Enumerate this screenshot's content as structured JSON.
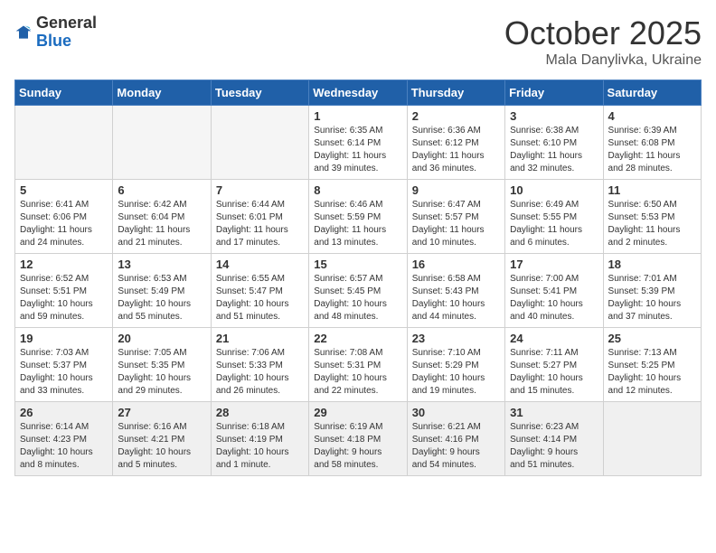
{
  "logo": {
    "general": "General",
    "blue": "Blue"
  },
  "header": {
    "month": "October 2025",
    "location": "Mala Danylivka, Ukraine"
  },
  "weekdays": [
    "Sunday",
    "Monday",
    "Tuesday",
    "Wednesday",
    "Thursday",
    "Friday",
    "Saturday"
  ],
  "weeks": [
    [
      {
        "day": "",
        "info": ""
      },
      {
        "day": "",
        "info": ""
      },
      {
        "day": "",
        "info": ""
      },
      {
        "day": "1",
        "info": "Sunrise: 6:35 AM\nSunset: 6:14 PM\nDaylight: 11 hours\nand 39 minutes."
      },
      {
        "day": "2",
        "info": "Sunrise: 6:36 AM\nSunset: 6:12 PM\nDaylight: 11 hours\nand 36 minutes."
      },
      {
        "day": "3",
        "info": "Sunrise: 6:38 AM\nSunset: 6:10 PM\nDaylight: 11 hours\nand 32 minutes."
      },
      {
        "day": "4",
        "info": "Sunrise: 6:39 AM\nSunset: 6:08 PM\nDaylight: 11 hours\nand 28 minutes."
      }
    ],
    [
      {
        "day": "5",
        "info": "Sunrise: 6:41 AM\nSunset: 6:06 PM\nDaylight: 11 hours\nand 24 minutes."
      },
      {
        "day": "6",
        "info": "Sunrise: 6:42 AM\nSunset: 6:04 PM\nDaylight: 11 hours\nand 21 minutes."
      },
      {
        "day": "7",
        "info": "Sunrise: 6:44 AM\nSunset: 6:01 PM\nDaylight: 11 hours\nand 17 minutes."
      },
      {
        "day": "8",
        "info": "Sunrise: 6:46 AM\nSunset: 5:59 PM\nDaylight: 11 hours\nand 13 minutes."
      },
      {
        "day": "9",
        "info": "Sunrise: 6:47 AM\nSunset: 5:57 PM\nDaylight: 11 hours\nand 10 minutes."
      },
      {
        "day": "10",
        "info": "Sunrise: 6:49 AM\nSunset: 5:55 PM\nDaylight: 11 hours\nand 6 minutes."
      },
      {
        "day": "11",
        "info": "Sunrise: 6:50 AM\nSunset: 5:53 PM\nDaylight: 11 hours\nand 2 minutes."
      }
    ],
    [
      {
        "day": "12",
        "info": "Sunrise: 6:52 AM\nSunset: 5:51 PM\nDaylight: 10 hours\nand 59 minutes."
      },
      {
        "day": "13",
        "info": "Sunrise: 6:53 AM\nSunset: 5:49 PM\nDaylight: 10 hours\nand 55 minutes."
      },
      {
        "day": "14",
        "info": "Sunrise: 6:55 AM\nSunset: 5:47 PM\nDaylight: 10 hours\nand 51 minutes."
      },
      {
        "day": "15",
        "info": "Sunrise: 6:57 AM\nSunset: 5:45 PM\nDaylight: 10 hours\nand 48 minutes."
      },
      {
        "day": "16",
        "info": "Sunrise: 6:58 AM\nSunset: 5:43 PM\nDaylight: 10 hours\nand 44 minutes."
      },
      {
        "day": "17",
        "info": "Sunrise: 7:00 AM\nSunset: 5:41 PM\nDaylight: 10 hours\nand 40 minutes."
      },
      {
        "day": "18",
        "info": "Sunrise: 7:01 AM\nSunset: 5:39 PM\nDaylight: 10 hours\nand 37 minutes."
      }
    ],
    [
      {
        "day": "19",
        "info": "Sunrise: 7:03 AM\nSunset: 5:37 PM\nDaylight: 10 hours\nand 33 minutes."
      },
      {
        "day": "20",
        "info": "Sunrise: 7:05 AM\nSunset: 5:35 PM\nDaylight: 10 hours\nand 29 minutes."
      },
      {
        "day": "21",
        "info": "Sunrise: 7:06 AM\nSunset: 5:33 PM\nDaylight: 10 hours\nand 26 minutes."
      },
      {
        "day": "22",
        "info": "Sunrise: 7:08 AM\nSunset: 5:31 PM\nDaylight: 10 hours\nand 22 minutes."
      },
      {
        "day": "23",
        "info": "Sunrise: 7:10 AM\nSunset: 5:29 PM\nDaylight: 10 hours\nand 19 minutes."
      },
      {
        "day": "24",
        "info": "Sunrise: 7:11 AM\nSunset: 5:27 PM\nDaylight: 10 hours\nand 15 minutes."
      },
      {
        "day": "25",
        "info": "Sunrise: 7:13 AM\nSunset: 5:25 PM\nDaylight: 10 hours\nand 12 minutes."
      }
    ],
    [
      {
        "day": "26",
        "info": "Sunrise: 6:14 AM\nSunset: 4:23 PM\nDaylight: 10 hours\nand 8 minutes."
      },
      {
        "day": "27",
        "info": "Sunrise: 6:16 AM\nSunset: 4:21 PM\nDaylight: 10 hours\nand 5 minutes."
      },
      {
        "day": "28",
        "info": "Sunrise: 6:18 AM\nSunset: 4:19 PM\nDaylight: 10 hours\nand 1 minute."
      },
      {
        "day": "29",
        "info": "Sunrise: 6:19 AM\nSunset: 4:18 PM\nDaylight: 9 hours\nand 58 minutes."
      },
      {
        "day": "30",
        "info": "Sunrise: 6:21 AM\nSunset: 4:16 PM\nDaylight: 9 hours\nand 54 minutes."
      },
      {
        "day": "31",
        "info": "Sunrise: 6:23 AM\nSunset: 4:14 PM\nDaylight: 9 hours\nand 51 minutes."
      },
      {
        "day": "",
        "info": ""
      }
    ]
  ]
}
